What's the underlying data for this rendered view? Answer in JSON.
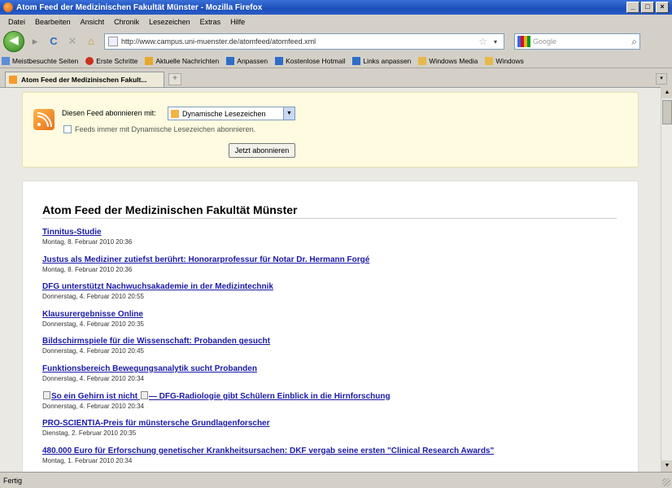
{
  "window": {
    "title": "Atom Feed der Medizinischen Fakultät Münster - Mozilla Firefox",
    "minimize": "_",
    "maximize": "□",
    "close": "×"
  },
  "menu": [
    "Datei",
    "Bearbeiten",
    "Ansicht",
    "Chronik",
    "Lesezeichen",
    "Extras",
    "Hilfe"
  ],
  "nav": {
    "url": "http://www.campus.uni-muenster.de/atomfeed/atomfeed.xml",
    "search_placeholder": "Google",
    "back": "◀",
    "forward": "▸",
    "reload": "C",
    "stop": "✕",
    "home": "⌂",
    "star": "☆",
    "dropdown": "▾",
    "search": "⌕"
  },
  "bookmarks": [
    {
      "label": "Meistbesuchte Seiten",
      "color": "#5b8ed6"
    },
    {
      "label": "Erste Schritte",
      "color": "#c8321e"
    },
    {
      "label": "Aktuelle Nachrichten",
      "color": "#e7a92b"
    },
    {
      "label": "Anpassen",
      "color": "#2e6ec9"
    },
    {
      "label": "Kostenlose Hotmail",
      "color": "#2e6ec9"
    },
    {
      "label": "Links anpassen",
      "color": "#2e6ec9"
    },
    {
      "label": "Windows Media",
      "color": "#e7b84a"
    },
    {
      "label": "Windows",
      "color": "#e7b84a"
    }
  ],
  "tab": {
    "label": "Atom Feed der Medizinischen Fakult...",
    "new_tab": "+",
    "list": "▾"
  },
  "subscribe": {
    "label": "Diesen Feed abonnieren mit:",
    "selected_reader": "Dynamische Lesezeichen",
    "always_label": "Feeds immer mit Dynamische Lesezeichen abonnieren.",
    "always_checked": false,
    "button": "Jetzt abonnieren",
    "select_arrow": "▼"
  },
  "feed": {
    "title": "Atom Feed der Medizinischen Fakultät Münster",
    "entries": [
      {
        "title": "Tinnitus-Studie",
        "date": "Montag, 8. Februar 2010 20:36"
      },
      {
        "title": "Justus als Mediziner zutiefst berührt: Honorarprofessur für Notar Dr. Hermann Forgé",
        "date": "Montag, 8. Februar 2010 20:36"
      },
      {
        "title": "DFG unterstützt Nachwuchsakademie in der Medizintechnik",
        "date": "Donnerstag, 4. Februar 2010 20:55"
      },
      {
        "title": "Klausurergebnisse Online",
        "date": "Donnerstag, 4. Februar 2010 20:35"
      },
      {
        "title": "Bildschirmspiele für die Wissenschaft: Probanden gesucht",
        "date": "Donnerstag, 4. Februar 2010 20:45"
      },
      {
        "title": "Funktionsbereich Bewegungsanalytik sucht Probanden",
        "date": "Donnerstag, 4. Februar 2010 20:34"
      },
      {
        "title_pre": "So ein Gehirn ist nicht",
        "title_mid": "— DFG-Radiologie gibt Schülern Einblick in die Hirnforschung",
        "date": "Donnerstag, 4. Februar 2010 20:34"
      },
      {
        "title": "PRO-SCIENTIA-Preis für münstersche Grundlagenforscher",
        "date": "Dienstag, 2. Februar 2010 20:35"
      },
      {
        "title": "480.000 Euro für Erforschung genetischer Krankheitsursachen: DKF vergab seine ersten \"Clinical Research Awards\"",
        "date": "Montag, 1. Februar 2010 20:34"
      }
    ]
  },
  "status": {
    "text": "Fertig"
  },
  "scroll": {
    "up": "▲",
    "down": "▼"
  }
}
